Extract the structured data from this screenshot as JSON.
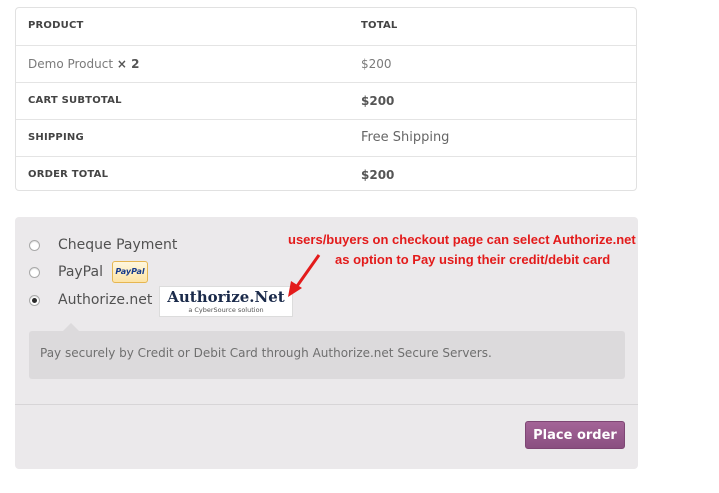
{
  "order_table": {
    "header": {
      "product": "PRODUCT",
      "total": "TOTAL"
    },
    "item": {
      "name": "Demo Product",
      "qty": "× 2",
      "total": "$200"
    },
    "cart_subtotal": {
      "label": "CART SUBTOTAL",
      "value": "$200"
    },
    "shipping": {
      "label": "SHIPPING",
      "value": "Free Shipping"
    },
    "order_total": {
      "label": "ORDER TOTAL",
      "value": "$200"
    }
  },
  "payment": {
    "methods": [
      {
        "label": "Cheque Payment",
        "selected": false
      },
      {
        "label": "PayPal",
        "selected": false
      },
      {
        "label": "Authorize.net",
        "selected": true
      }
    ],
    "paypal_badge": "PayPal",
    "authorize_logo": {
      "main": "Authorize.Net",
      "sub": "a CyberSource solution"
    },
    "description": "Pay securely by Credit or Debit Card through Authorize.net Secure Servers.",
    "place_order": "Place order"
  },
  "annotation": {
    "line1": "users/buyers on checkout page can select Authorize.net",
    "line2": "as option to Pay using their credit/debit card",
    "color": "#e31b1b"
  },
  "colors": {
    "button": "#96588a",
    "panel": "#ebe9eb"
  }
}
